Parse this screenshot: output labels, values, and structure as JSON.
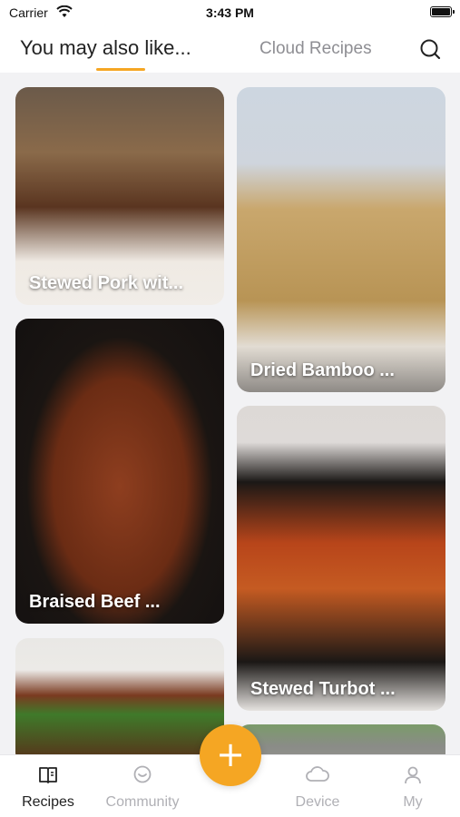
{
  "status": {
    "carrier": "Carrier",
    "time": "3:43 PM"
  },
  "header": {
    "tab_main": "You may also like...",
    "tab_cloud": "Cloud Recipes",
    "search_icon": "search-icon"
  },
  "colors": {
    "accent": "#f5a623",
    "inactive": "#b0b0b5",
    "active": "#222222"
  },
  "recipes": [
    {
      "title": "Stewed Pork wit..."
    },
    {
      "title": "Dried Bamboo ..."
    },
    {
      "title": "Braised Beef ..."
    },
    {
      "title": "Stewed Turbot ..."
    },
    {
      "title": ""
    },
    {
      "title": ""
    }
  ],
  "tabbar": {
    "items": [
      {
        "label": "Recipes",
        "icon": "book-icon",
        "active": true
      },
      {
        "label": "Community",
        "icon": "chat-icon",
        "active": false
      },
      {
        "label": "Device",
        "icon": "cloud-icon",
        "active": false
      },
      {
        "label": "My",
        "icon": "person-icon",
        "active": false
      }
    ],
    "fab_label": "+"
  }
}
